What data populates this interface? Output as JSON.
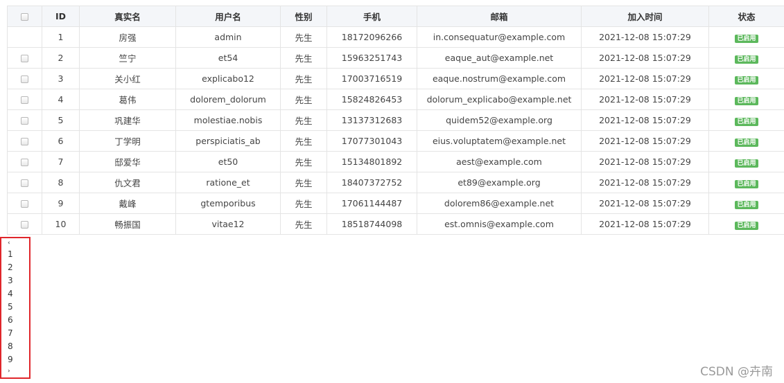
{
  "table": {
    "headers": [
      "ID",
      "真实名",
      "用户名",
      "性别",
      "手机",
      "邮箱",
      "加入时间",
      "状态"
    ],
    "rows": [
      {
        "id": "1",
        "name": "房强",
        "username": "admin",
        "gender": "先生",
        "phone": "18172096266",
        "email": "in.consequatur@example.com",
        "joined": "2021-12-08 15:07:29",
        "status": "已启用"
      },
      {
        "id": "2",
        "name": "竺宁",
        "username": "et54",
        "gender": "先生",
        "phone": "15963251743",
        "email": "eaque_aut@example.net",
        "joined": "2021-12-08 15:07:29",
        "status": "已启用"
      },
      {
        "id": "3",
        "name": "关小红",
        "username": "explicabo12",
        "gender": "先生",
        "phone": "17003716519",
        "email": "eaque.nostrum@example.com",
        "joined": "2021-12-08 15:07:29",
        "status": "已启用"
      },
      {
        "id": "4",
        "name": "葛伟",
        "username": "dolorem_dolorum",
        "gender": "先生",
        "phone": "15824826453",
        "email": "dolorum_explicabo@example.net",
        "joined": "2021-12-08 15:07:29",
        "status": "已启用"
      },
      {
        "id": "5",
        "name": "巩建华",
        "username": "molestiae.nobis",
        "gender": "先生",
        "phone": "13137312683",
        "email": "quidem52@example.org",
        "joined": "2021-12-08 15:07:29",
        "status": "已启用"
      },
      {
        "id": "6",
        "name": "丁学明",
        "username": "perspiciatis_ab",
        "gender": "先生",
        "phone": "17077301043",
        "email": "eius.voluptatem@example.net",
        "joined": "2021-12-08 15:07:29",
        "status": "已启用"
      },
      {
        "id": "7",
        "name": "邸爱华",
        "username": "et50",
        "gender": "先生",
        "phone": "15134801892",
        "email": "aest@example.com",
        "joined": "2021-12-08 15:07:29",
        "status": "已启用"
      },
      {
        "id": "8",
        "name": "仇文君",
        "username": "ratione_et",
        "gender": "先生",
        "phone": "18407372752",
        "email": "et89@example.org",
        "joined": "2021-12-08 15:07:29",
        "status": "已启用"
      },
      {
        "id": "9",
        "name": "戴峰",
        "username": "gtemporibus",
        "gender": "先生",
        "phone": "17061144487",
        "email": "dolorem86@example.net",
        "joined": "2021-12-08 15:07:29",
        "status": "已启用"
      },
      {
        "id": "10",
        "name": "畅振国",
        "username": "vitae12",
        "gender": "先生",
        "phone": "18518744098",
        "email": "est.omnis@example.com",
        "joined": "2021-12-08 15:07:29",
        "status": "已启用"
      }
    ],
    "row_checkbox_hidden": [
      true,
      false,
      false,
      false,
      false,
      false,
      false,
      false,
      false,
      false
    ]
  },
  "pagination": {
    "prev": "‹",
    "pages": [
      "1",
      "2",
      "3",
      "4",
      "5",
      "6",
      "7",
      "8",
      "9"
    ],
    "next": "›"
  },
  "watermark": "CSDN @卉南",
  "colors": {
    "status_badge": "#5cb85c",
    "highlight_border": "#e0262b",
    "header_bg": "#f4f6f9"
  }
}
